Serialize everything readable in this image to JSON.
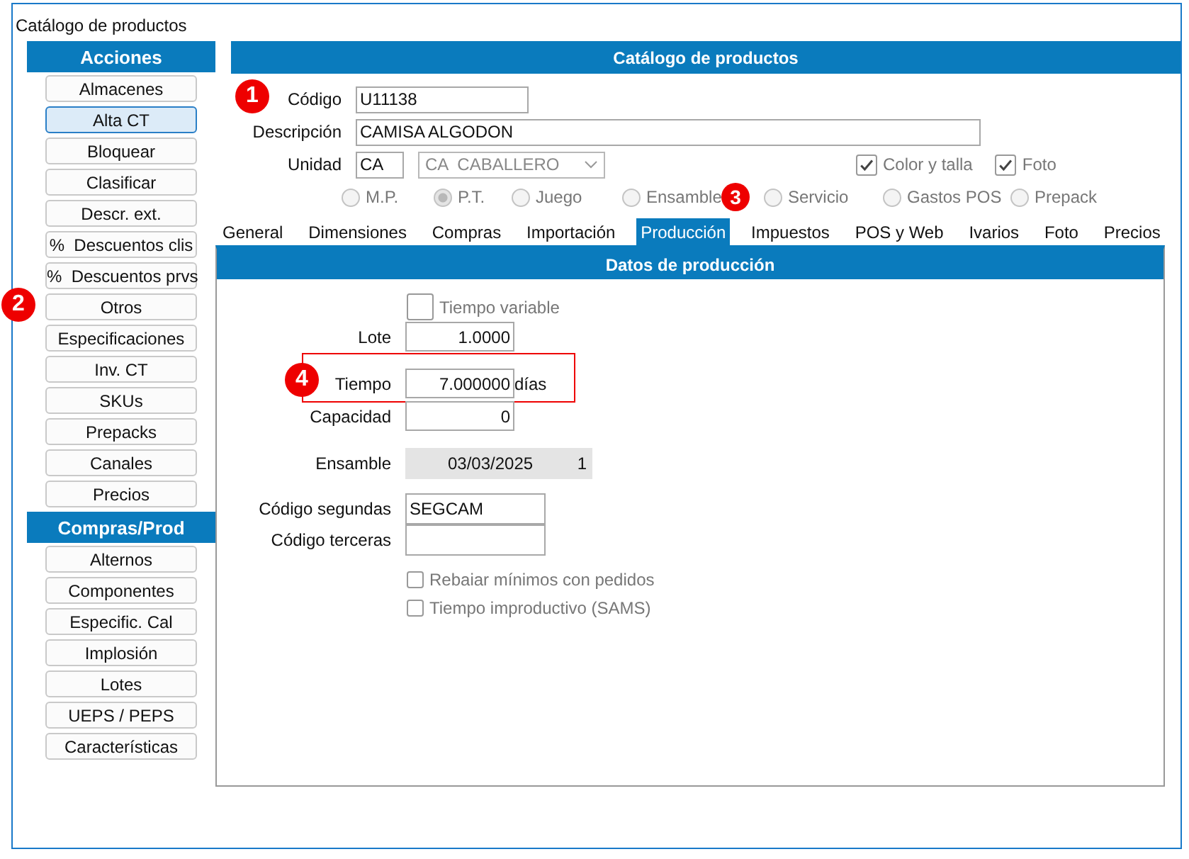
{
  "window": {
    "title": "Catálogo de productos"
  },
  "sidebar": {
    "sections": [
      {
        "title": "Acciones",
        "buttons": [
          {
            "label": "Almacenes",
            "selected": false
          },
          {
            "label": "Alta CT",
            "selected": true
          },
          {
            "label": "Bloquear",
            "selected": false
          },
          {
            "label": "Clasificar",
            "selected": false
          },
          {
            "label": "Descr. ext.",
            "selected": false
          },
          {
            "label": "%  Descuentos clis",
            "selected": false
          },
          {
            "label": "%  Descuentos prvs",
            "selected": false
          },
          {
            "label": "Otros",
            "selected": false
          },
          {
            "label": "Especificaciones",
            "selected": false
          },
          {
            "label": "Inv. CT",
            "selected": false
          },
          {
            "label": "SKUs",
            "selected": false
          },
          {
            "label": "Prepacks",
            "selected": false
          },
          {
            "label": "Canales",
            "selected": false
          },
          {
            "label": "Precios",
            "selected": false
          }
        ]
      },
      {
        "title": "Compras/Prod",
        "buttons": [
          {
            "label": "Alternos",
            "selected": false
          },
          {
            "label": "Componentes",
            "selected": false
          },
          {
            "label": "Especific. Cal",
            "selected": false
          },
          {
            "label": "Implosión",
            "selected": false
          },
          {
            "label": "Lotes",
            "selected": false
          },
          {
            "label": "UEPS / PEPS",
            "selected": false
          },
          {
            "label": "Características",
            "selected": false
          }
        ]
      }
    ]
  },
  "header": {
    "title": "Catálogo de productos"
  },
  "code": {
    "label": "Código",
    "value": "U11138"
  },
  "description": {
    "label": "Descripción",
    "value": "CAMISA ALGODON"
  },
  "unit": {
    "label": "Unidad",
    "value": "CA",
    "combo": "CA  CABALLERO"
  },
  "options": [
    {
      "label": "Color y talla",
      "checked": true
    },
    {
      "label": "Foto",
      "checked": true
    }
  ],
  "product_types": [
    {
      "label": "M.P.",
      "selected": false
    },
    {
      "label": "P.T.",
      "selected": true
    },
    {
      "label": "Juego",
      "selected": false
    },
    {
      "label": "Ensamble",
      "selected": false
    },
    {
      "label": "Servicio",
      "selected": false
    },
    {
      "label": "Gastos POS",
      "selected": false
    },
    {
      "label": "Prepack",
      "selected": false
    }
  ],
  "tabs": [
    {
      "label": "General",
      "selected": false
    },
    {
      "label": "Dimensiones",
      "selected": false
    },
    {
      "label": "Compras",
      "selected": false
    },
    {
      "label": "Importación",
      "selected": false
    },
    {
      "label": "Producción",
      "selected": true
    },
    {
      "label": "Impuestos",
      "selected": false
    },
    {
      "label": "POS y Web",
      "selected": false
    },
    {
      "label": "Ivarios",
      "selected": false
    },
    {
      "label": "Foto",
      "selected": false
    },
    {
      "label": "Precios",
      "selected": false
    }
  ],
  "production": {
    "title": "Datos de producción",
    "variable_time": {
      "label": "Tiempo variable",
      "checked": false
    },
    "lot": {
      "label": "Lote",
      "value": "1.0000"
    },
    "time": {
      "label": "Tiempo",
      "value": "7.000000",
      "unit": "días"
    },
    "capacity": {
      "label": "Capacidad",
      "value": "0"
    },
    "assembly": {
      "label": "Ensamble",
      "date": "03/03/2025",
      "count": "1"
    },
    "second_code": {
      "label": "Código segundas",
      "value": "SEGCAM"
    },
    "third_code": {
      "label": "Código terceras"
    },
    "flags": [
      {
        "label": "Rebaiar mínimos con pedidos",
        "checked": false
      },
      {
        "label": "Tiempo improductivo (SAMS)",
        "checked": false
      }
    ]
  },
  "markers": [
    "1",
    "2",
    "3",
    "4"
  ]
}
